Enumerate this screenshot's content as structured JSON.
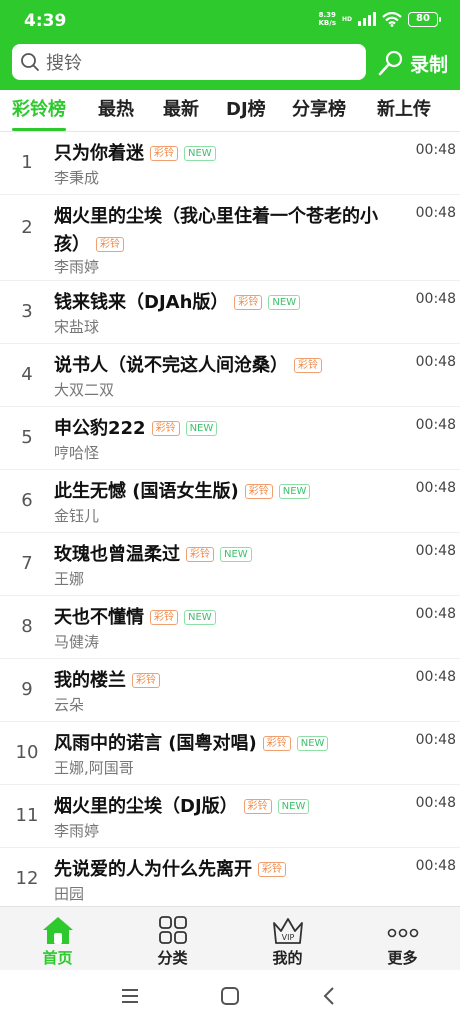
{
  "status_bar": {
    "time": "4:39",
    "net_speed_value": "8.39",
    "net_speed_unit": "KB/s",
    "signal": "HD",
    "battery": "80"
  },
  "search": {
    "placeholder": "搜铃",
    "record_label": "录制"
  },
  "tabs": [
    {
      "label": "彩铃榜",
      "active": true
    },
    {
      "label": "最热",
      "active": false
    },
    {
      "label": "最新",
      "active": false
    },
    {
      "label": "DJ榜",
      "active": false
    },
    {
      "label": "分享榜",
      "active": false
    },
    {
      "label": "新上传",
      "active": false
    }
  ],
  "badges": {
    "ring": "彩铃",
    "new": "NEW"
  },
  "songs": [
    {
      "rank": "1",
      "title": "只为你着迷",
      "artist": "李秉成",
      "duration": "00:48",
      "ring": true,
      "new": true
    },
    {
      "rank": "2",
      "title": "烟火里的尘埃（我心里住着一个苍老的小孩）",
      "artist": "李雨婷",
      "duration": "00:48",
      "ring": true,
      "new": false
    },
    {
      "rank": "3",
      "title": "钱来钱来（DJAh版）",
      "artist": "宋盐球",
      "duration": "00:48",
      "ring": true,
      "new": true
    },
    {
      "rank": "4",
      "title": "说书人（说不完这人间沧桑）",
      "artist": "大双二双",
      "duration": "00:48",
      "ring": true,
      "new": false
    },
    {
      "rank": "5",
      "title": "申公豹222",
      "artist": "哼哈怪",
      "duration": "00:48",
      "ring": true,
      "new": true
    },
    {
      "rank": "6",
      "title": "此生无憾 (国语女生版)",
      "artist": "金钰儿",
      "duration": "00:48",
      "ring": true,
      "new": true
    },
    {
      "rank": "7",
      "title": "玫瑰也曾温柔过",
      "artist": "王娜",
      "duration": "00:48",
      "ring": true,
      "new": true
    },
    {
      "rank": "8",
      "title": "天也不懂情",
      "artist": "马健涛",
      "duration": "00:48",
      "ring": true,
      "new": true
    },
    {
      "rank": "9",
      "title": "我的楼兰",
      "artist": "云朵",
      "duration": "00:48",
      "ring": true,
      "new": false
    },
    {
      "rank": "10",
      "title": "风雨中的诺言 (国粤对唱)",
      "artist": "王娜,阿国哥",
      "duration": "00:48",
      "ring": true,
      "new": true
    },
    {
      "rank": "11",
      "title": "烟火里的尘埃（DJ版）",
      "artist": "李雨婷",
      "duration": "00:48",
      "ring": true,
      "new": true
    },
    {
      "rank": "12",
      "title": "先说爱的人为什么先离开",
      "artist": "田园",
      "duration": "00:48",
      "ring": true,
      "new": false
    }
  ],
  "bottom_nav": [
    {
      "label": "首页",
      "icon": "home-icon",
      "active": true
    },
    {
      "label": "分类",
      "icon": "grid-icon",
      "active": false
    },
    {
      "label": "我的",
      "icon": "vip-crown-icon",
      "active": false
    },
    {
      "label": "更多",
      "icon": "more-dots-icon",
      "active": false
    }
  ],
  "colors": {
    "brand_green": "#2dc92d",
    "ring_badge": "#f08a48",
    "new_badge": "#3cbf6a"
  }
}
